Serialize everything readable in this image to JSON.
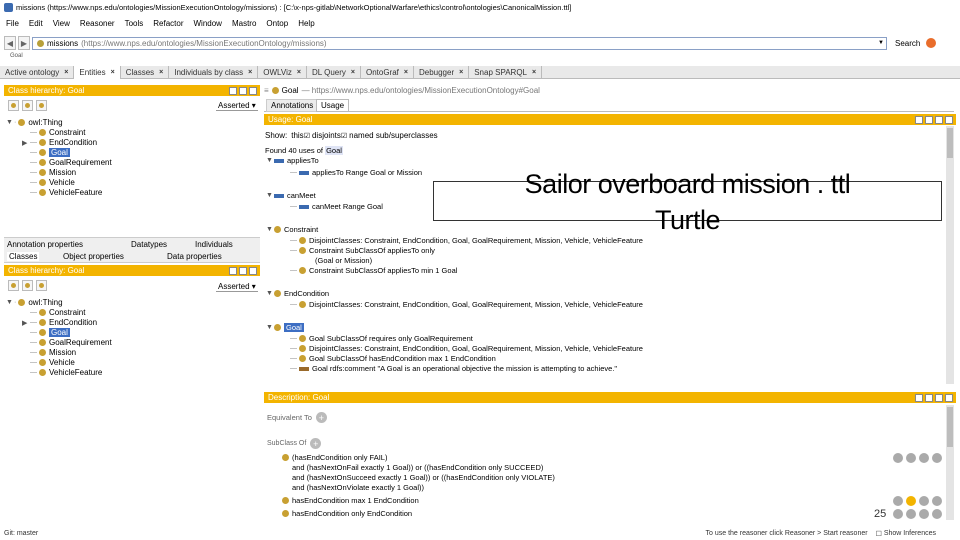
{
  "window": {
    "title": "missions (https://www.nps.edu/ontologies/MissionExecutionOntology/missions) : [C:\\x-nps-gitlab\\NetworkOptionalWarfare\\ethics\\control\\ontologies\\CanonicalMission.ttl]"
  },
  "menu": [
    "File",
    "Edit",
    "View",
    "Reasoner",
    "Tools",
    "Refactor",
    "Window",
    "Mastro",
    "Ontop",
    "Help"
  ],
  "address": {
    "name": "missions",
    "iri": "(https://www.nps.edu/ontologies/MissionExecutionOntology/missions)",
    "search_label": "Search"
  },
  "breadcrumb": "Goal",
  "tabs": [
    {
      "label": "Active ontology"
    },
    {
      "label": "Entities"
    },
    {
      "label": "Classes"
    },
    {
      "label": "Individuals by class"
    },
    {
      "label": "OWLViz"
    },
    {
      "label": "DL Query"
    },
    {
      "label": "OntoGraf"
    },
    {
      "label": "Debugger"
    },
    {
      "label": "Snap SPARQL"
    }
  ],
  "left_top": {
    "title": "Class hierarchy: Goal",
    "asserted": "Asserted",
    "root": "owl:Thing",
    "items": [
      "Constraint",
      "EndCondition",
      "Goal",
      "GoalRequirement",
      "Mission",
      "Vehicle",
      "VehicleFeature"
    ]
  },
  "left_mid_tabs": [
    "Annotation properties",
    "Datatypes",
    "Individuals",
    "Classes",
    "Object properties",
    "Data properties"
  ],
  "left_bottom": {
    "title": "Class hierarchy: Goal",
    "asserted": "Asserted",
    "root": "owl:Thing",
    "items": [
      "Constraint",
      "EndCondition",
      "Goal",
      "GoalRequirement",
      "Mission",
      "Vehicle",
      "VehicleFeature"
    ]
  },
  "right_header": {
    "entity": "Goal",
    "iri": "— https://www.nps.edu/ontologies/MissionExecutionOntology#Goal",
    "subtabs": [
      "Annotations",
      "Usage"
    ]
  },
  "usage": {
    "title": "Usage: Goal",
    "show_label": "Show:",
    "this_label": "this",
    "disjoints_label": "disjoints",
    "named_label": "named sub/superclasses",
    "found": "Found 40 uses of",
    "found_entity": "Goal",
    "sections": [
      {
        "name": "appliesTo",
        "lines": [
          "appliesTo Range Goal or Mission"
        ]
      },
      {
        "name": "canMeet",
        "lines": [
          "canMeet Range Goal"
        ]
      },
      {
        "name": "Constraint",
        "lines": [
          "DisjointClasses: Constraint, EndCondition, Goal, GoalRequirement, Mission, Vehicle, VehicleFeature",
          "Constraint SubClassOf appliesTo only",
          "(Goal or Mission)",
          "Constraint SubClassOf appliesTo min 1 Goal"
        ]
      },
      {
        "name": "EndCondition",
        "lines": [
          "DisjointClasses: Constraint, EndCondition, Goal, GoalRequirement, Mission, Vehicle, VehicleFeature"
        ]
      },
      {
        "name": "Goal",
        "lines": [
          "Goal SubClassOf requires only GoalRequirement",
          "DisjointClasses: Constraint, EndCondition, Goal, GoalRequirement, Mission, Vehicle, VehicleFeature",
          "Goal SubClassOf hasEndCondition max 1 EndCondition",
          "Goal rdfs:comment \"A Goal is an operational objective the mission is attempting to achieve.\""
        ]
      }
    ]
  },
  "description": {
    "title": "Description: Goal",
    "equivalent_label": "Equivalent To",
    "subclass_label": "SubClass Of",
    "axioms": [
      "(hasEndCondition only FAIL)",
      "and (hasNextOnFail exactly 1 Goal)) or ((hasEndCondition only SUCCEED)",
      "and (hasNextOnSucceed exactly 1 Goal)) or ((hasEndCondition only VIOLATE)",
      "and (hasNextOnViolate exactly 1 Goal))"
    ],
    "axiom2": "hasEndCondition max 1 EndCondition",
    "axiom3": "hasEndCondition only EndCondition"
  },
  "overlay": {
    "line1": "Sailor overboard mission . ttl",
    "line2": "Turtle"
  },
  "page_number": "25",
  "status": {
    "left": "Git: master",
    "right": "To use the reasoner click Reasoner > Start reasoner",
    "show_inferences": "Show Inferences"
  }
}
